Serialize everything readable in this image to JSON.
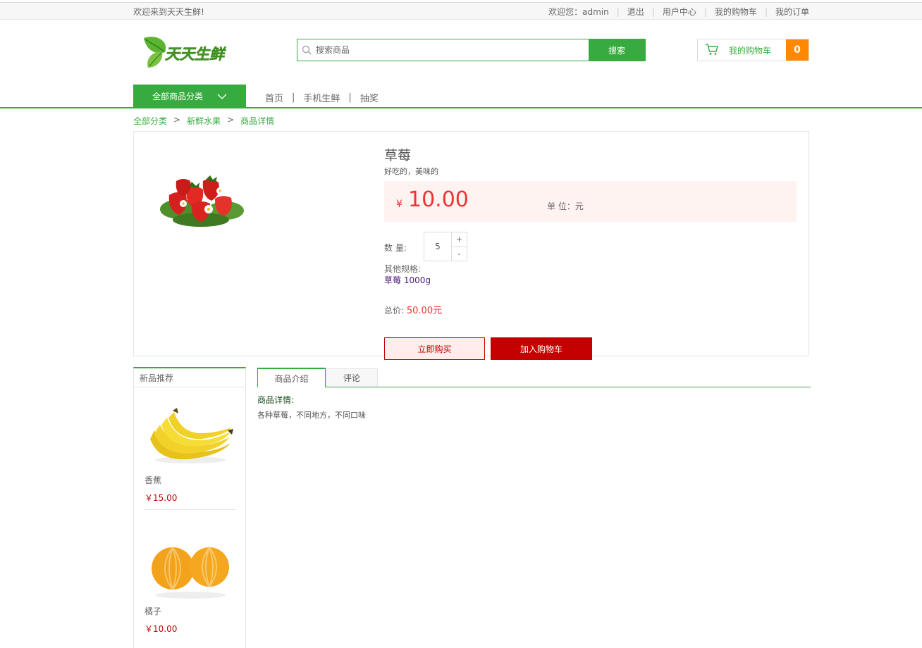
{
  "topbar": {
    "welcome": "欢迎来到天天生鲜!",
    "greeting": "欢迎您：",
    "username": "admin",
    "logout": "退出",
    "user_center": "用户中心",
    "my_cart": "我的购物车",
    "my_orders": "我的订单"
  },
  "header": {
    "logo_text": "天天生鲜",
    "search_placeholder": "搜索商品",
    "search_button": "搜索",
    "cart_label": "我的购物车",
    "cart_count": "0"
  },
  "nav": {
    "all_categories": "全部商品分类",
    "links": [
      "首页",
      "手机生鲜",
      "抽奖"
    ]
  },
  "breadcrumb": [
    "全部分类",
    "新鲜水果",
    "商品详情"
  ],
  "product": {
    "name": "草莓",
    "description": "好吃的，美味的",
    "currency": "¥",
    "price": "10.00",
    "unit_label": "单 位：元",
    "quantity_label": "数 量:",
    "quantity": "5",
    "plus": "+",
    "minus": "-",
    "other_spec_label": "其他规格:",
    "other_spec": "草莓 1000g",
    "total_label": "总价:",
    "total": "50.00元",
    "buy_now": "立即购买",
    "add_to_cart": "加入购物车"
  },
  "sidebar": {
    "title": "新品推荐",
    "items": [
      {
        "name": "香蕉",
        "price": "￥15.00"
      },
      {
        "name": "橘子",
        "price": "￥10.00"
      }
    ]
  },
  "tabs": {
    "intro": "商品介绍",
    "comments": "评论",
    "detail_heading": "商品详情:",
    "detail_text": "各种草莓，不同地方，不同口味"
  },
  "colors": {
    "brand_green": "#37ab40",
    "price_red": "#e33333",
    "button_red": "#c40000",
    "cart_orange": "#ff8800"
  }
}
